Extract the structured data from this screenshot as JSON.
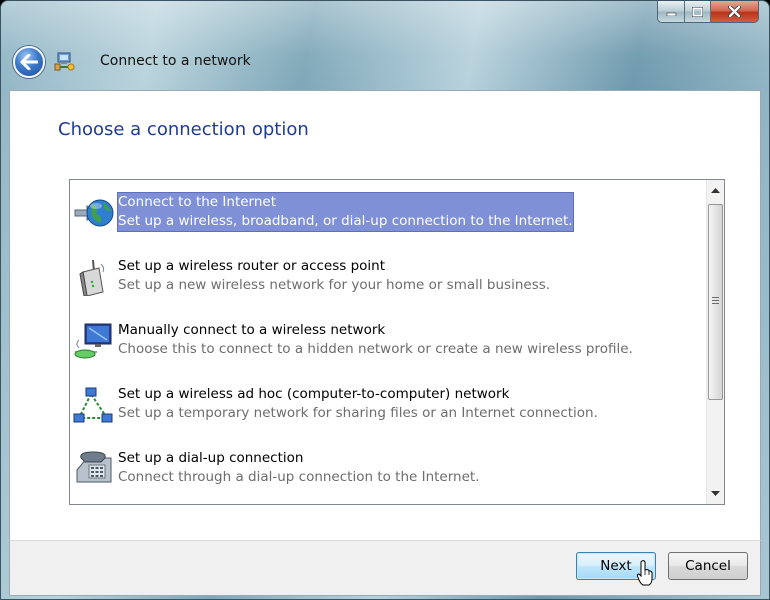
{
  "window": {
    "title": "Connect to a network",
    "caption_buttons": [
      "minimize",
      "maximize",
      "close"
    ]
  },
  "header": {
    "back_icon": "back-arrow-icon",
    "app_icon": "network-connection-icon"
  },
  "main": {
    "heading": "Choose a connection option",
    "selected_index": 0,
    "options": [
      {
        "title": "Connect to the Internet",
        "description": "Set up a wireless, broadband, or dial-up connection to the Internet.",
        "icon": "globe-icon"
      },
      {
        "title": "Set up a wireless router or access point",
        "description": "Set up a new wireless network for your home or small business.",
        "icon": "wireless-router-icon"
      },
      {
        "title": "Manually connect to a wireless network",
        "description": "Choose this to connect to a hidden network or create a new wireless profile.",
        "icon": "wireless-network-computer-icon"
      },
      {
        "title": "Set up a wireless ad hoc (computer-to-computer) network",
        "description": "Set up a temporary network for sharing files or an Internet connection.",
        "icon": "ad-hoc-network-icon"
      },
      {
        "title": "Set up a dial-up connection",
        "description": "Connect through a dial-up connection to the Internet.",
        "icon": "telephone-modem-icon"
      }
    ]
  },
  "footer": {
    "next_label": "Next",
    "cancel_label": "Cancel"
  },
  "colors": {
    "heading": "#1f3c8f",
    "selection": "#7f90d6"
  }
}
